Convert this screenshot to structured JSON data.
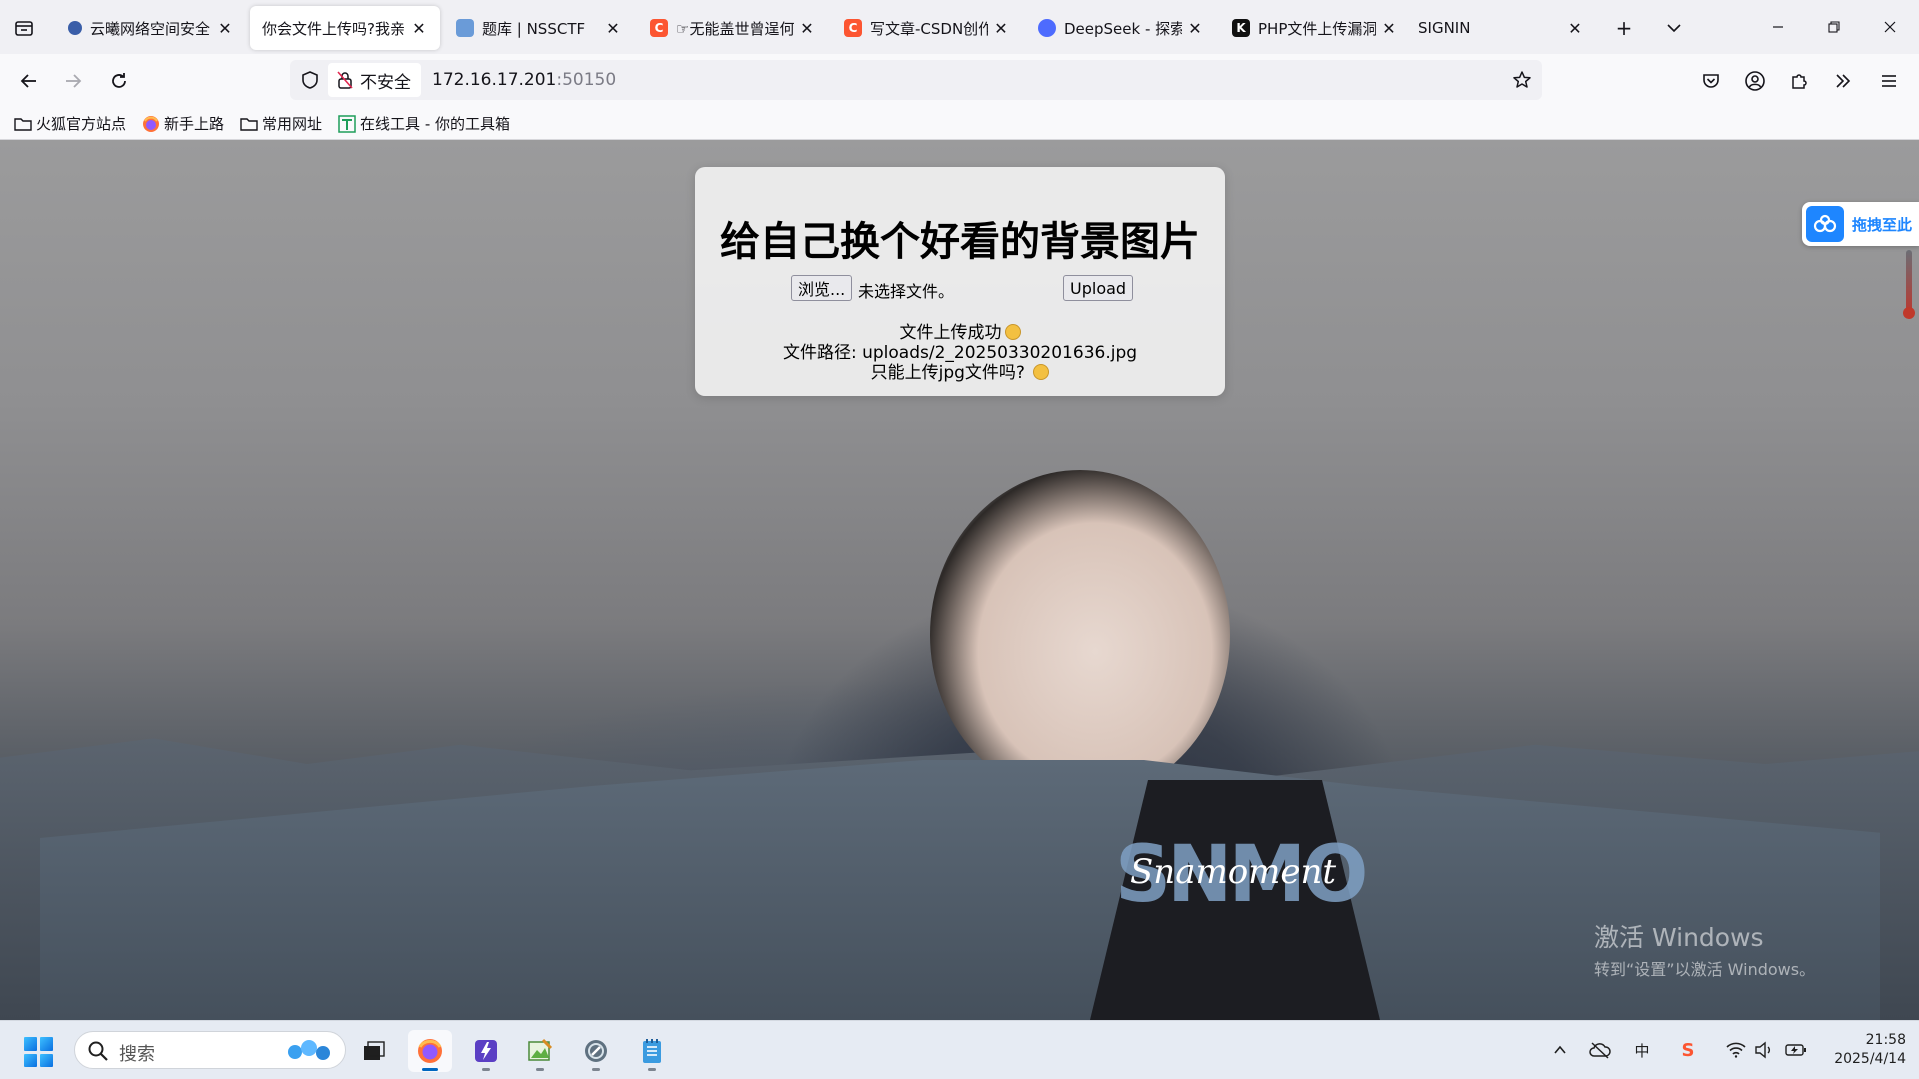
{
  "browser": {
    "tabs": [
      {
        "title": "云曦网络空间安全",
        "favicon": "globe-icon",
        "favicon_color": "#3a5ea8",
        "active": false
      },
      {
        "title": "你会文件上传吗?我亲",
        "favicon": "none",
        "favicon_color": "",
        "active": true
      },
      {
        "title": "题库 | NSSCTF",
        "favicon": "nssctf-icon",
        "favicon_color": "#6a9bd8",
        "active": false
      },
      {
        "title": "☞无能盖世曾逞何",
        "favicon": "csdn-icon",
        "favicon_color": "#fc5531",
        "active": false
      },
      {
        "title": "写文章-CSDN创作",
        "favicon": "csdn-icon",
        "favicon_color": "#fc5531",
        "active": false
      },
      {
        "title": "DeepSeek - 探索",
        "favicon": "deepseek-icon",
        "favicon_color": "#4d6bfe",
        "active": false
      },
      {
        "title": "PHP文件上传漏洞",
        "favicon": "k-icon",
        "favicon_color": "#111111",
        "active": false
      },
      {
        "title": "SIGNIN",
        "favicon": "none",
        "favicon_color": "",
        "active": false
      }
    ],
    "security_label": "不安全",
    "url_host": "172.16.17.201",
    "url_port": ":50150",
    "bookmarks": [
      {
        "label": "火狐官方站点",
        "icon": "folder-icon"
      },
      {
        "label": "新手上路",
        "icon": "firefox-icon"
      },
      {
        "label": "常用网址",
        "icon": "folder-icon"
      },
      {
        "label": "在线工具 - 你的工具箱",
        "icon": "tool-icon"
      }
    ]
  },
  "page": {
    "title": "给自己换个好看的背景图片",
    "browse_label": "浏览...",
    "file_status": "未选择文件。",
    "upload_label": "Upload",
    "message_success": "文件上传成功",
    "message_path": "文件路径: uploads/2_20250330201636.jpg",
    "message_question": "只能上传jpg文件吗?",
    "shirt_print": "SNMOMENT",
    "shirt_script": "Snamoment",
    "baidu_label": "拖拽至此",
    "activate_title": "激活 Windows",
    "activate_sub": "转到“设置”以激活 Windows。"
  },
  "taskbar": {
    "search_label": "搜索",
    "time": "21:58",
    "date": "2025/4/14",
    "ime_label": "中",
    "sogou_label": "S"
  },
  "colors": {
    "accent": "#0067c0",
    "csdn": "#fc5531",
    "baidu": "#1e86ff"
  }
}
